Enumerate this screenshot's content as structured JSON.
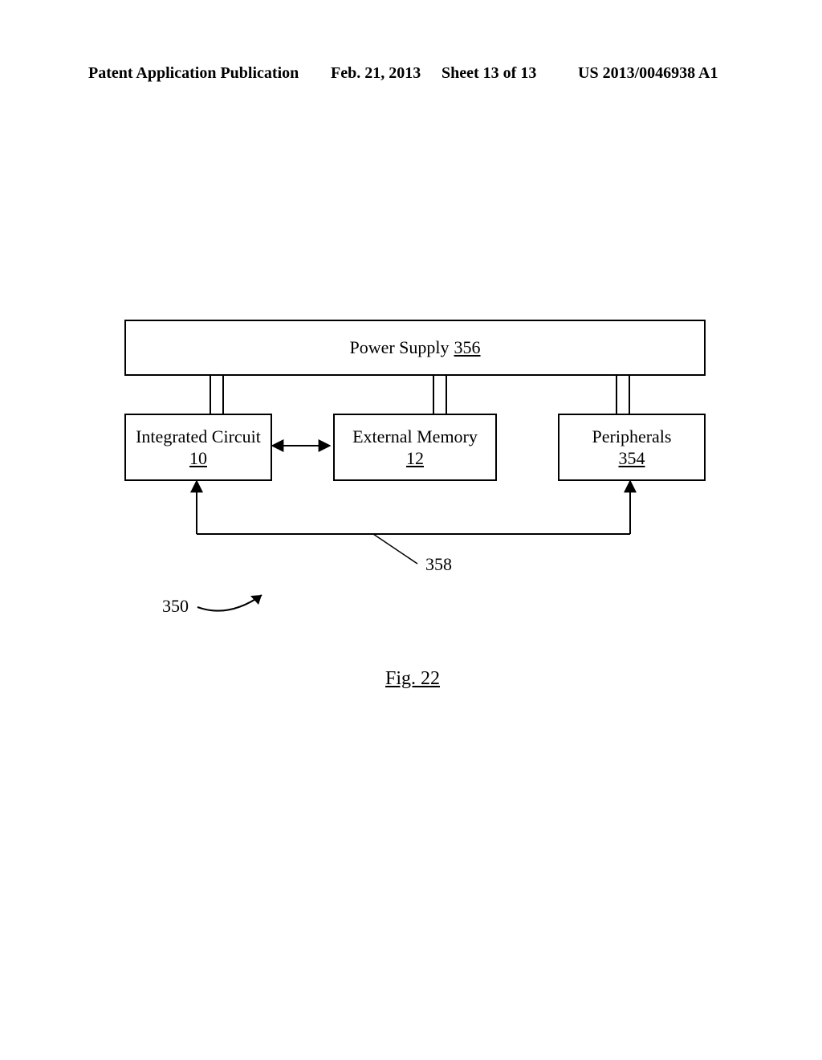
{
  "header": {
    "publication": "Patent Application Publication",
    "date": "Feb. 21, 2013",
    "sheet": "Sheet 13 of 13",
    "doc_number": "US 2013/0046938 A1"
  },
  "diagram": {
    "power_supply": {
      "label": "Power Supply",
      "ref": "356"
    },
    "integrated_circuit": {
      "label": "Integrated Circuit",
      "ref": "10"
    },
    "external_memory": {
      "label": "External Memory",
      "ref": "12"
    },
    "peripherals": {
      "label": "Peripherals",
      "ref": "354"
    },
    "bus_ref": "358",
    "system_ref": "350"
  },
  "figure_caption": "Fig. 22"
}
